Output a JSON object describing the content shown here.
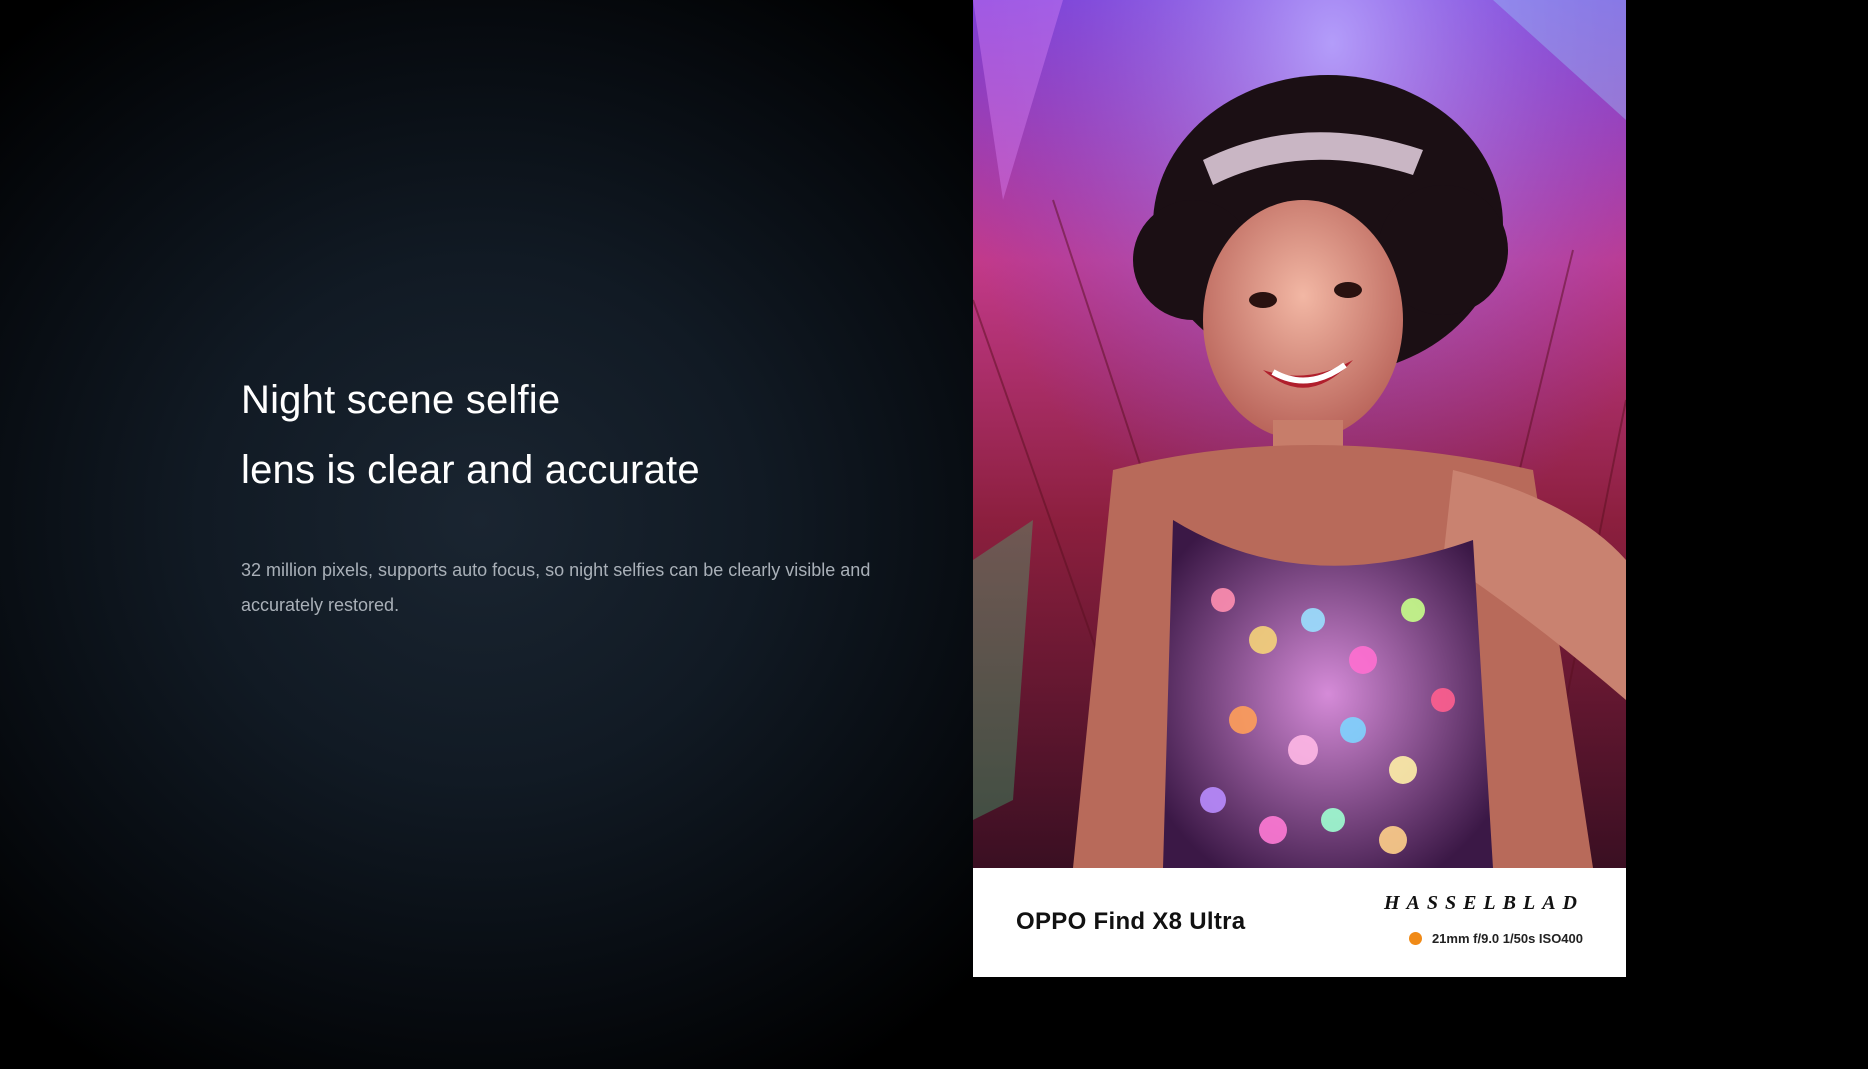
{
  "section": {
    "headline_line1": "Night scene selfie",
    "headline_line2": "lens is clear and accurate",
    "description": "32 million pixels, supports auto focus, so night selfies can be clearly visible and accurately restored."
  },
  "photo_card": {
    "model": "OPPO Find X8 Ultra",
    "brand": "HASSELBLAD",
    "specs": "21mm  f/9.0  1/50s  ISO400",
    "dot_color": "#f08a17"
  },
  "colors": {
    "background": "#000000",
    "headline": "#ffffff",
    "description": "#a9b0b8"
  }
}
